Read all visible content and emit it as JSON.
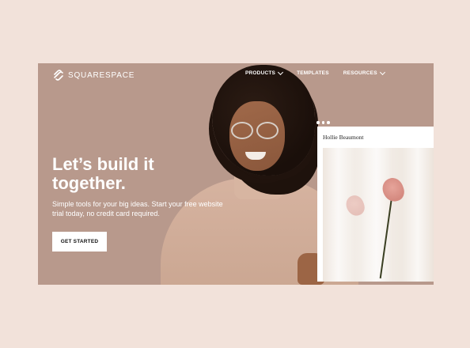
{
  "brand": {
    "name": "SQUARESPACE",
    "logo_icon": "squarespace-logo-icon"
  },
  "nav": {
    "items": [
      {
        "label": "PRODUCTS",
        "has_dropdown": true
      },
      {
        "label": "TEMPLATES",
        "has_dropdown": false
      },
      {
        "label": "RESOURCES",
        "has_dropdown": true
      }
    ]
  },
  "hero": {
    "headline": "Let’s build it together.",
    "subtext": "Simple tools for your big ideas. Start your free website trial today, no credit card required.",
    "cta_label": "GET STARTED"
  },
  "template_card": {
    "title": "Hollie Beaumont",
    "dots_icon": "three-dots-icon",
    "image": "flower-photo"
  },
  "colors": {
    "page_bg": "#f2e2da",
    "hero_bg": "#b8998c",
    "text_light": "#ffffff"
  }
}
